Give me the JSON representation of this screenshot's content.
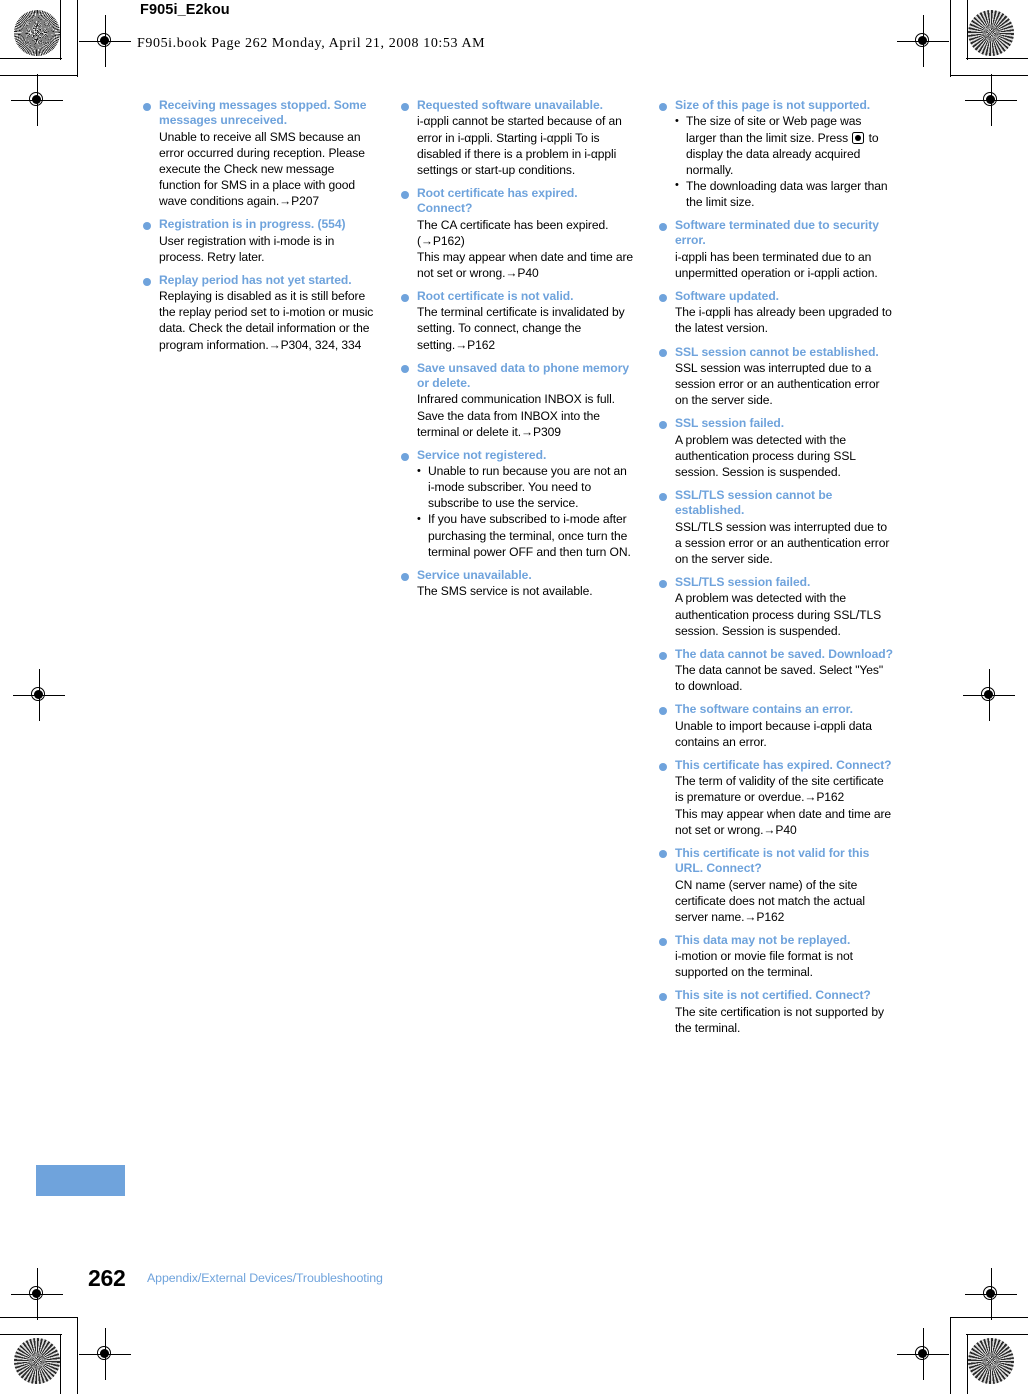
{
  "header": {
    "doc_id": "F905i_E2kou",
    "book_line": "F905i.book  Page 262  Monday, April 21, 2008  10:53 AM"
  },
  "footer": {
    "page_number": "262",
    "section_title": "Appendix/External Devices/Troubleshooting"
  },
  "colors": {
    "accent_blue": "#6fa3dc",
    "body_text": "#000000"
  },
  "columns": [
    {
      "entries": [
        {
          "title": "Receiving messages stopped. Some messages unreceived.",
          "paragraphs": [
            "Unable to receive all SMS because an error occurred during reception. Please execute the Check new message function for SMS in a place with good wave conditions again.→P207"
          ]
        },
        {
          "title": "Registration is in progress. (554)",
          "paragraphs": [
            "User registration with i-mode is in process. Retry later."
          ]
        },
        {
          "title": "Replay period has not yet started.",
          "paragraphs": [
            "Replaying is disabled as it is still before the replay period set to i-motion or music data. Check the detail information or the program information.→P304, 324, 334"
          ]
        }
      ]
    },
    {
      "entries": [
        {
          "title": "Requested software unavailable.",
          "paragraphs": [
            "i-αppli cannot be started because of an error in i-αppli. Starting i-αppli To is disabled if there is a problem in i-αppli settings or start-up conditions."
          ]
        },
        {
          "title": "Root certificate has expired. Connect?",
          "paragraphs": [
            "The CA certificate has been expired. (→P162)",
            "This may appear when date and time are not set or wrong.→P40"
          ]
        },
        {
          "title": "Root certificate is not valid.",
          "paragraphs": [
            "The terminal certificate is invalidated by setting. To connect, change the setting.→P162"
          ]
        },
        {
          "title": "Save unsaved data to phone memory or delete.",
          "paragraphs": [
            "Infrared communication INBOX is full. Save the data from INBOX into the terminal or delete it.→P309"
          ]
        },
        {
          "title": "Service not registered.",
          "bullets": [
            "Unable to run because you are not an i-mode subscriber. You need to subscribe to use the service.",
            "If you have subscribed to i-mode after purchasing the terminal, once turn the terminal power OFF and then turn ON."
          ]
        },
        {
          "title": "Service unavailable.",
          "paragraphs": [
            "The SMS service is not available."
          ]
        }
      ]
    },
    {
      "entries": [
        {
          "title": "Size of this page is not supported.",
          "bullets_html": [
            "The size of site or Web page was larger than the limit size. Press <span class=\"keyicon\" data-name=\"center-key-icon\" data-interactable=\"false\"></span> to display the data already acquired normally.",
            "The downloading data was larger than the limit size."
          ]
        },
        {
          "title": "Software terminated due to security error.",
          "paragraphs": [
            "i-αppli has been terminated due to an unpermitted operation or i-αppli action."
          ]
        },
        {
          "title": "Software updated.",
          "paragraphs": [
            "The i-αppli has already been upgraded to the latest version."
          ]
        },
        {
          "title": "SSL session cannot be established.",
          "paragraphs": [
            "SSL session was interrupted due to a session error or an authentication error on the server side."
          ]
        },
        {
          "title": "SSL session failed.",
          "paragraphs": [
            "A problem was detected with the authentication process during SSL session. Session is suspended."
          ]
        },
        {
          "title": "SSL/TLS session cannot be established.",
          "paragraphs": [
            "SSL/TLS session was interrupted due to a session error or an authentication error on the server side."
          ]
        },
        {
          "title": "SSL/TLS session failed.",
          "paragraphs": [
            "A problem was detected with the authentication process during SSL/TLS session. Session is suspended."
          ]
        },
        {
          "title": "The data cannot be saved. Download?",
          "paragraphs": [
            "The data cannot be saved. Select \"Yes\" to download."
          ]
        },
        {
          "title": "The software contains an error.",
          "paragraphs": [
            "Unable to import because i-αppli data contains an error."
          ]
        },
        {
          "title": "This certificate has expired. Connect?",
          "paragraphs": [
            "The term of validity of the site certificate is premature or overdue.→P162",
            "This may appear when date and time are not set or wrong.→P40"
          ]
        },
        {
          "title": "This certificate is not valid for this URL. Connect?",
          "paragraphs": [
            "CN name (server name) of the site certificate does not match the actual server name.→P162"
          ]
        },
        {
          "title": "This data may not be replayed.",
          "paragraphs": [
            "i-motion or movie file format is not supported on the terminal."
          ]
        },
        {
          "title": "This site is not certified. Connect?",
          "paragraphs": [
            "The site certification is not supported by the terminal."
          ]
        }
      ]
    }
  ]
}
